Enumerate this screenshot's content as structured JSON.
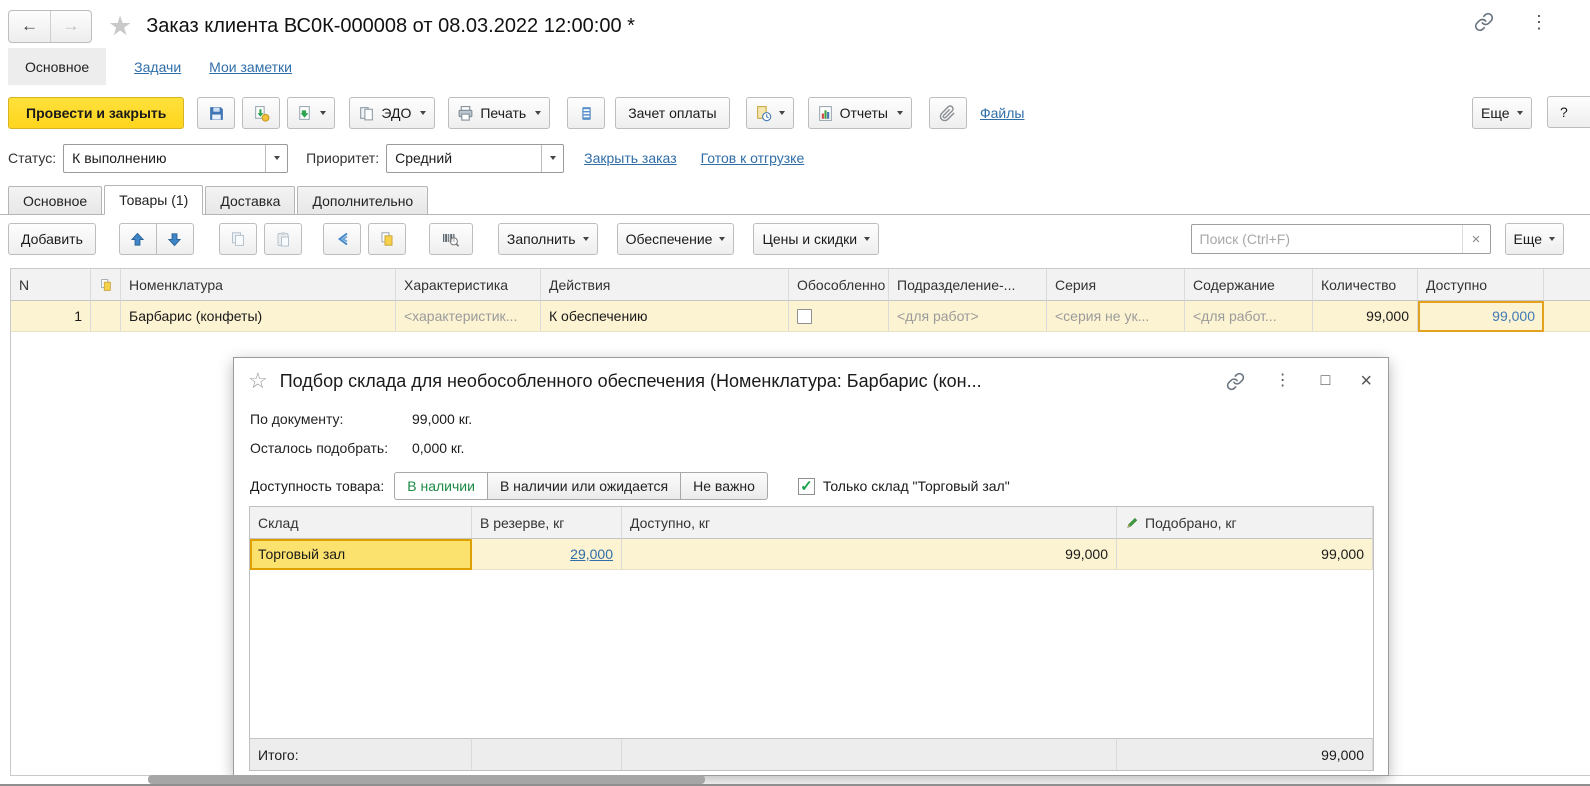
{
  "icons": {
    "back": "←",
    "forward": "→",
    "star": "★",
    "star_outline": "☆",
    "kebab": "⋮",
    "maximize": "□",
    "close": "×",
    "clear": "×",
    "help": "?",
    "check": "✓"
  },
  "window": {
    "title": "Заказ клиента ВС0К-000008 от 08.03.2022 12:00:00 *",
    "nav_tabs": [
      {
        "label": "Основное"
      },
      {
        "label": "Задачи"
      },
      {
        "label": "Мои заметки"
      }
    ]
  },
  "toolbar": {
    "post_and_close": "Провести и закрыть",
    "edo": "ЭДО",
    "print": "Печать",
    "payment_offset": "Зачет оплаты",
    "reports": "Отчеты",
    "files": "Файлы",
    "more": "Еще"
  },
  "status_row": {
    "status_label": "Статус:",
    "status_value": "К выполнению",
    "priority_label": "Приоритет:",
    "priority_value": "Средний",
    "close_order": "Закрыть заказ",
    "ready_to_ship": "Готов к отгрузке"
  },
  "detail_tabs": [
    {
      "label": "Основное"
    },
    {
      "label": "Товары (1)"
    },
    {
      "label": "Доставка"
    },
    {
      "label": "Дополнительно"
    }
  ],
  "table_toolbar": {
    "add": "Добавить",
    "fill": "Заполнить",
    "provision": "Обеспечение",
    "prices_discounts": "Цены и скидки",
    "search_placeholder": "Поиск (Ctrl+F)",
    "more": "Еще"
  },
  "goods_table": {
    "headers": {
      "n": "N",
      "nomenclature": "Номенклатура",
      "characteristic": "Характеристика",
      "actions": "Действия",
      "separate": "Обособленно",
      "department": "Подразделение-...",
      "series": "Серия",
      "content": "Содержание",
      "quantity": "Количество",
      "available": "Доступно"
    },
    "rows": [
      {
        "n": "1",
        "nomenclature": "Барбарис (конфеты)",
        "characteristic": "<характеристик...",
        "actions": "К обеспечению",
        "department": "<для работ>",
        "series": "<серия не ук...",
        "content": "<для работ...",
        "quantity": "99,000",
        "available": "99,000"
      }
    ]
  },
  "modal": {
    "title": "Подбор склада для необособленного обеспечения (Номенклатура: Барбарис (кон...",
    "by_document_label": "По документу:",
    "by_document_value": "99,000 кг.",
    "remaining_label": "Осталось подобрать:",
    "remaining_value": "0,000 кг.",
    "availability_label": "Доступность товара:",
    "availability_options": [
      {
        "label": "В наличии"
      },
      {
        "label": "В наличии или ожидается"
      },
      {
        "label": "Не важно"
      }
    ],
    "only_warehouse_label": "Только склад \"Торговый зал\"",
    "table": {
      "headers": {
        "warehouse": "Склад",
        "reserve": "В резерве, кг",
        "available": "Доступно, кг",
        "picked": "Подобрано, кг"
      },
      "rows": [
        {
          "warehouse": "Торговый зал",
          "reserve": "29,000",
          "available": "99,000",
          "picked": "99,000"
        }
      ],
      "total_label": "Итого:",
      "total_value": "99,000"
    }
  },
  "colors": {
    "accent_yellow": "#ffd92e",
    "row_selection_yellow": "#fcf3d2",
    "selected_cell_border": "#e2a21f",
    "link_blue": "#306ea8",
    "success_green": "#17a24b"
  }
}
